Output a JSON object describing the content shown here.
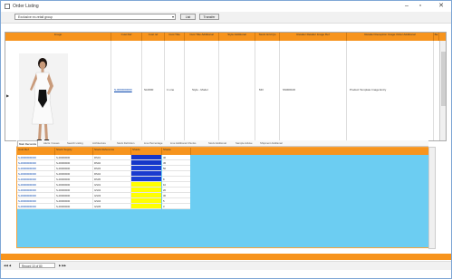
{
  "window": {
    "title": "Order Listing",
    "controls": {
      "minimize": "–",
      "maximize": "▫",
      "close": "✕"
    }
  },
  "toolbar": {
    "combo_value": "Exclusive ex-retail group",
    "list_label": "List",
    "transfer_label": "Transfer"
  },
  "main_grid": {
    "columns": [
      "Image",
      "Cust Ref",
      "Cust ref",
      "Cust Title",
      "Cust Title Additional",
      "Style Additional",
      "Stock Grid Qu",
      "Retailer Retailer Image Ref",
      "Retailer Reception Image Order Additional",
      "Ba"
    ],
    "row": {
      "link": "S-0000000000",
      "code": "SL0000",
      "qty": "1 Line",
      "style": "Style - Model",
      "grid": "MO",
      "ref": "SS000100",
      "desc": "Product Template Image Entry"
    }
  },
  "tabs": [
    "Main Reconcile",
    "Alerts / Issues",
    "Search Listing",
    "Architecture",
    "Stock Definition",
    "Line Percentage",
    "Line Additional Chunks",
    "Stock Additional",
    "Sample Advise",
    "Shipment Additional"
  ],
  "sub_grid": {
    "columns": [
      "Cust Ref",
      "Stock Supply",
      "Stock Reference",
      "Shade",
      "Shade"
    ],
    "rows": [
      {
        "ref": "S-00000000000",
        "supply": "S-00000000",
        "stock": "RS01",
        "swatch": "#1537c9",
        "shade": "40"
      },
      {
        "ref": "S-00000000000",
        "supply": "S-00000000",
        "stock": "RS02",
        "swatch": "#1537c9",
        "shade": "45"
      },
      {
        "ref": "S-00000000000",
        "supply": "S-00000000",
        "stock": "RS03",
        "swatch": "#1b3fd4",
        "shade": "50"
      },
      {
        "ref": "S-00000000000",
        "supply": "S-00000000",
        "stock": "RS04",
        "swatch": "#1a3bcf",
        "shade": ""
      },
      {
        "ref": "S-00000000000",
        "supply": "S-00000000",
        "stock": "RS05",
        "swatch": "#1b3fd4",
        "shade": "8"
      },
      {
        "ref": "S-00000000000",
        "supply": "S-00000000",
        "stock": "GS01",
        "swatch": "#ffff00",
        "shade": "10"
      },
      {
        "ref": "S-00000000000",
        "supply": "S-00000000",
        "stock": "GS02",
        "swatch": "#ffff00",
        "shade": "20"
      },
      {
        "ref": "S-00000000000",
        "supply": "S-00000000",
        "stock": "GS03",
        "swatch": "#ffff00",
        "shade": "30"
      },
      {
        "ref": "S-00000000000",
        "supply": "S-00000000",
        "stock": "GS04",
        "swatch": "#ffff00",
        "shade": "5"
      },
      {
        "ref": "S-00000000000",
        "supply": "S-00000000",
        "stock": "GS05",
        "swatch": "#ffff00",
        "shade": "3"
      }
    ]
  },
  "pager": {
    "prefix": "◀◀  ◀",
    "page_text": "Record 10 of 80",
    "suffix": "▶  ▶▶"
  },
  "colors": {
    "accent": "#f7941d",
    "panel_bg": "#6ccdf2",
    "link": "#0645ad"
  }
}
